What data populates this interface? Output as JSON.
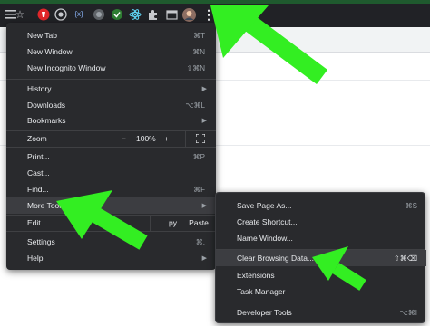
{
  "toolbar": {
    "icons": [
      "menu-icon",
      "star-icon",
      "red-extension-icon",
      "record-extension-icon",
      "code-extension-icon",
      "grey-extension-icon",
      "green-extension-icon",
      "react-extension-icon",
      "puzzle-extensions-icon",
      "tab-search-icon",
      "profile-avatar",
      "kebab-menu-icon"
    ],
    "code_ext_label": "{x}",
    "star_glyph": "☆",
    "kebab_glyph": "⋮"
  },
  "menu": {
    "new_tab": {
      "label": "New Tab",
      "shortcut": "⌘T"
    },
    "new_window": {
      "label": "New Window",
      "shortcut": "⌘N"
    },
    "new_incognito": {
      "label": "New Incognito Window",
      "shortcut": "⇧⌘N"
    },
    "history": {
      "label": "History",
      "arrow": "▶"
    },
    "downloads": {
      "label": "Downloads",
      "shortcut": "⌥⌘L"
    },
    "bookmarks": {
      "label": "Bookmarks",
      "arrow": "▶"
    },
    "zoom": {
      "label": "Zoom",
      "minus": "−",
      "value": "100%",
      "plus": "+"
    },
    "print": {
      "label": "Print...",
      "shortcut": "⌘P"
    },
    "cast": {
      "label": "Cast..."
    },
    "find": {
      "label": "Find...",
      "shortcut": "⌘F"
    },
    "more_tools": {
      "label": "More Tools",
      "arrow": "▶"
    },
    "edit": {
      "label": "Edit",
      "copy": "py",
      "paste": "Paste"
    },
    "settings": {
      "label": "Settings",
      "shortcut": "⌘,"
    },
    "help": {
      "label": "Help",
      "arrow": "▶"
    }
  },
  "submenu": {
    "save_page": {
      "label": "Save Page As...",
      "shortcut": "⌘S"
    },
    "create_shortcut": {
      "label": "Create Shortcut..."
    },
    "name_window": {
      "label": "Name Window..."
    },
    "clear_browsing": {
      "label": "Clear Browsing Data...",
      "shortcut": "⇧⌘⌫"
    },
    "extensions": {
      "label": "Extensions"
    },
    "task_manager": {
      "label": "Task Manager"
    },
    "developer_tools": {
      "label": "Developer Tools",
      "shortcut": "⌥⌘I"
    }
  },
  "colors": {
    "menu_bg": "#292a2d",
    "menu_text": "#e8eaed",
    "shortcut_text": "#9aa0a6",
    "highlight": "#3c3d41",
    "arrow_green": "#33ee22"
  }
}
